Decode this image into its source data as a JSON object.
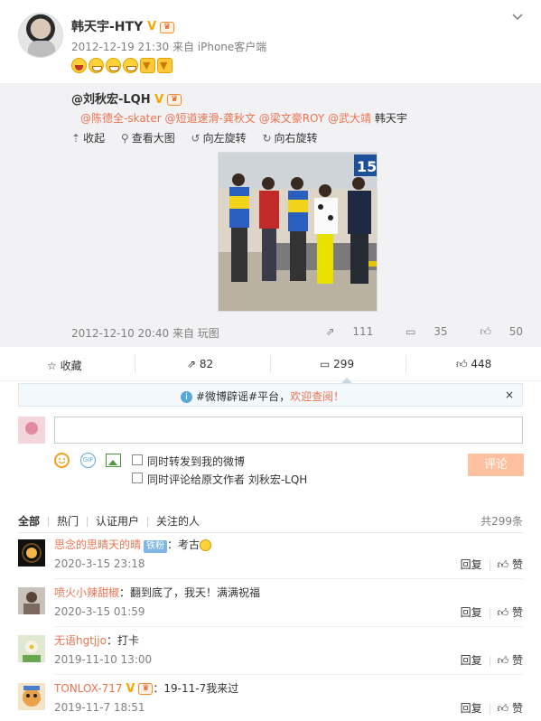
{
  "post": {
    "username": "韩天宇-HTY",
    "timestamp": "2012-12-19 21:30 来自 iPhone客户端"
  },
  "repost": {
    "author": "@刘秋宏-LQH",
    "mentions": [
      "@陈德全-skater",
      "@短道速滑-龚秋文",
      "@梁文豪ROY",
      "@武大靖"
    ],
    "mention_tail": "韩天宇",
    "tools": {
      "collapse": "收起",
      "view_large": "查看大图",
      "rotate_left": "向左旋转",
      "rotate_right": "向右旋转"
    },
    "photo_sign": "15",
    "timestamp": "2012-12-10 20:40 来自 玩图",
    "reposts": "111",
    "comments": "35",
    "likes": "50"
  },
  "actions": {
    "favorite": "收藏",
    "repost_count": "82",
    "comment_count": "299",
    "like_count": "448"
  },
  "notice": {
    "prefix": "#微博辟谣#平台，",
    "link": "欢迎查阅！",
    "close": "×"
  },
  "composer": {
    "placeholder": "",
    "gif": "GIF",
    "option_repost": "同时转发到我的微博",
    "option_comment_origin": "同时评论给原文作者 刘秋宏-LQH",
    "submit": "评论"
  },
  "filters": {
    "tabs": [
      "全部",
      "热门",
      "认证用户",
      "关注的人"
    ],
    "total": "共299条"
  },
  "comments": [
    {
      "name": "思念的思晴天的晴",
      "badge": "铁粉",
      "text": "：考古",
      "time": "2020-3-15 23:18",
      "reply": "回复",
      "like": "赞"
    },
    {
      "name": "喷火小辣甜椒",
      "text": "：翻到底了，我天！满满祝福",
      "time": "2020-3-15 01:59",
      "reply": "回复",
      "like": "赞"
    },
    {
      "name": "无语hgtjjo",
      "text": "：打卡",
      "time": "2019-11-10 13:00",
      "reply": "回复",
      "like": "赞"
    },
    {
      "name": "TONLOX-717",
      "text": "：19-11-7我来过",
      "time": "2019-11-7 18:51",
      "reply": "回复",
      "like": "赞"
    }
  ],
  "colors": {
    "accent": "#eb7350",
    "gold_v": "#f4a700",
    "submit_bg": "#ffc09f"
  },
  "icons": [
    "chevron-down-icon",
    "vip-v-icon",
    "crown-icon",
    "collapse-icon",
    "search-icon",
    "rotate-left-icon",
    "rotate-right-icon",
    "repost-icon",
    "comment-icon",
    "like-icon",
    "star-icon",
    "info-icon",
    "smiley-icon",
    "gif-icon",
    "image-icon"
  ]
}
